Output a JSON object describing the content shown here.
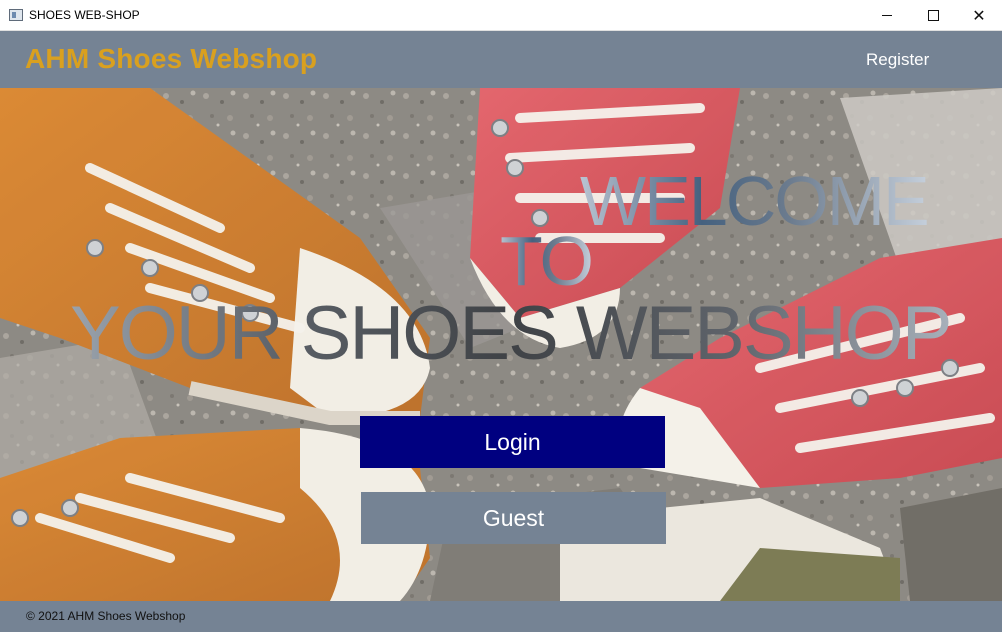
{
  "window": {
    "title": "SHOES WEB-SHOP",
    "controls": {
      "minimize_icon": "minimize-icon",
      "maximize_icon": "maximize-icon",
      "close_icon": "close-icon"
    }
  },
  "header": {
    "brand": "AHM Shoes Webshop",
    "register_label": "Register"
  },
  "hero": {
    "background_image": "sneakers-photo",
    "welcome_line1": "WELCOME",
    "welcome_line2": "TO",
    "welcome_line3": "YOUR SHOES WEBSHOP"
  },
  "actions": {
    "login_label": "Login",
    "guest_label": "Guest"
  },
  "footer": {
    "copyright": "© 2021 AHM Shoes Webshop"
  },
  "colors": {
    "header_bg": "#758394",
    "brand": "#d9a01f",
    "login_bg": "#000080",
    "guest_bg": "#758394"
  }
}
